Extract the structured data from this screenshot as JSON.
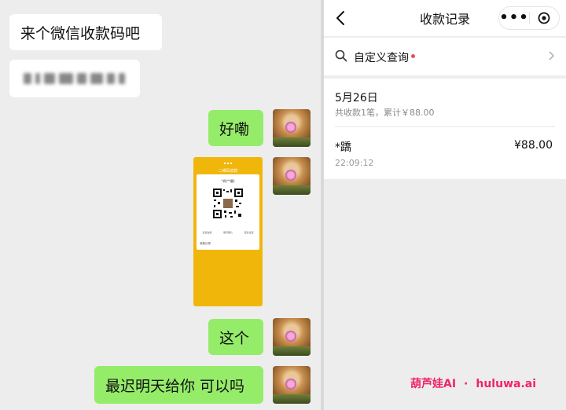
{
  "chat": {
    "messages": [
      {
        "text": "来个微信收款码吧",
        "side": "left"
      },
      {
        "text": "",
        "side": "left",
        "blurred": true
      },
      {
        "text": "好嘞",
        "side": "right"
      },
      {
        "text": "",
        "side": "right",
        "image": "qr-code-screenshot"
      },
      {
        "text": "这个",
        "side": "right"
      },
      {
        "text": "最迟明天给你 可以吗",
        "side": "right"
      }
    ],
    "qr_card": {
      "title": "二维码收款",
      "name": "*尚(**圆)",
      "links": [
        "设置金额",
        "保存图片",
        "更多设置"
      ],
      "record": "收款记录"
    }
  },
  "records": {
    "title": "收款记录",
    "query_label": "自定义查询",
    "day": {
      "date": "5月26日",
      "summary": "共收款1笔，累计￥88.00",
      "items": [
        {
          "payer": "*蹻",
          "amount": "¥88.00",
          "time": "22:09:12"
        }
      ]
    }
  },
  "watermark": {
    "brand": "葫芦娃AI",
    "separator": "·",
    "site": "huluwa.ai"
  },
  "colors": {
    "chat_bg": "#ededed",
    "green_bubble": "#95ec69",
    "qr_card": "#f0b60a",
    "red_dot": "#e94f4f",
    "watermark": "#f0246a"
  }
}
